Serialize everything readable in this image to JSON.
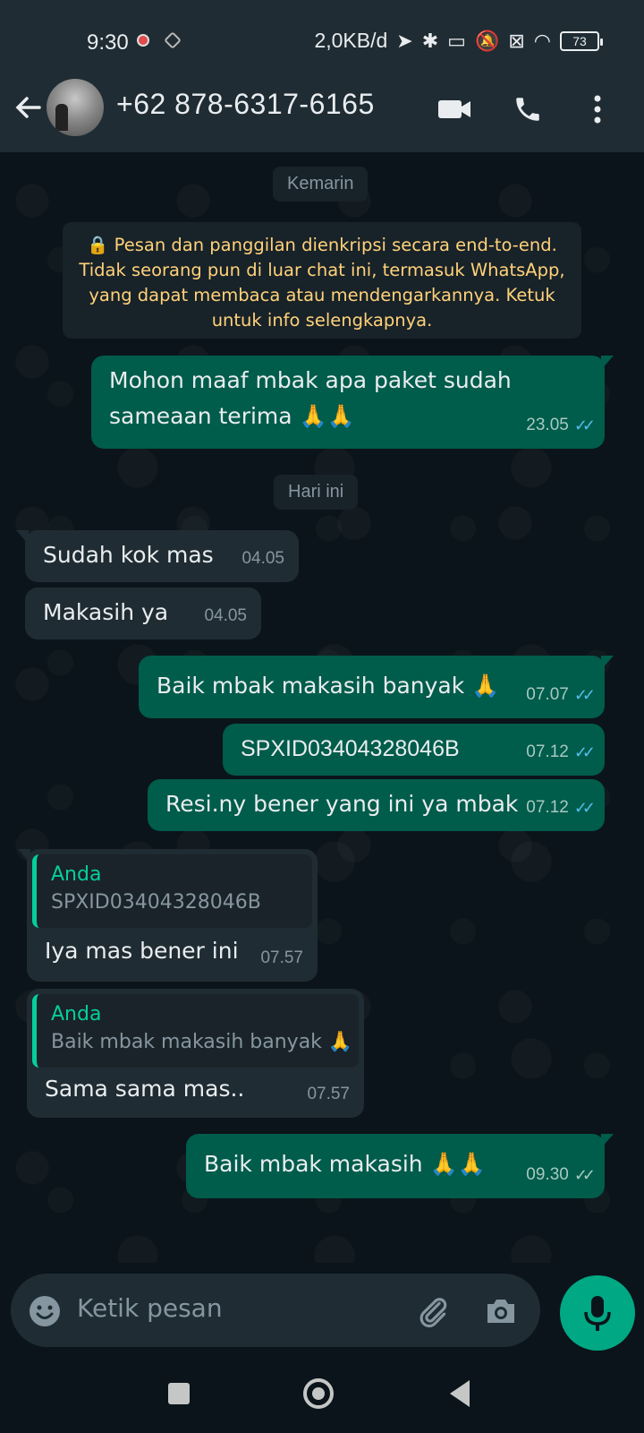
{
  "status_bar": {
    "time": "9:30",
    "network_speed": "2,0KB/d",
    "battery_level": "73"
  },
  "header": {
    "contact_name": "+62 878-6317-6165",
    "icons": [
      "back-arrow-icon",
      "video-call-icon",
      "phone-call-icon",
      "more-vert-icon"
    ]
  },
  "chat": {
    "date_yesterday": "Kemarin",
    "encryption_notice": "🔒 Pesan dan panggilan dienkripsi secara end-to-end. Tidak seorang pun di luar chat ini, termasuk WhatsApp, yang dapat membaca atau mendengarkannya. Ketuk untuk info selengkapnya.",
    "date_today": "Hari ini",
    "messages": [
      {
        "direction": "out",
        "text": "Mohon maaf mbak apa paket sudah sameaan terima 🙏🙏",
        "time": "23.05",
        "read": true
      },
      {
        "direction": "in",
        "text": "Sudah kok mas",
        "time": "04.05"
      },
      {
        "direction": "in",
        "text": "Makasih ya",
        "time": "04.05"
      },
      {
        "direction": "out",
        "text": "Baik mbak makasih banyak 🙏",
        "time": "07.07",
        "read": true
      },
      {
        "direction": "out",
        "text": "SPXID03404328046B",
        "time": "07.12",
        "read": true
      },
      {
        "direction": "out",
        "text": "Resi.ny bener yang ini ya mbak",
        "time": "07.12",
        "read": true
      },
      {
        "direction": "in",
        "quote_author": "Anda",
        "quote_text": "SPXID03404328046B",
        "text": "Iya mas bener ini",
        "time": "07.57"
      },
      {
        "direction": "in",
        "quote_author": "Anda",
        "quote_text": "Baik mbak makasih banyak 🙏",
        "text": "Sama sama mas..",
        "time": "07.57"
      },
      {
        "direction": "out",
        "text": "Baik mbak makasih 🙏🙏",
        "time": "09.30",
        "read": false
      }
    ]
  },
  "input": {
    "placeholder": "Ketik pesan"
  },
  "colors": {
    "header_bg": "#1f2c33",
    "chat_bg": "#0b141a",
    "outgoing_bubble": "#005c4b",
    "incoming_bubble": "#202c33",
    "accent": "#00a884",
    "read_ticks": "#53bdeb",
    "encryption_text": "#ffd279"
  }
}
